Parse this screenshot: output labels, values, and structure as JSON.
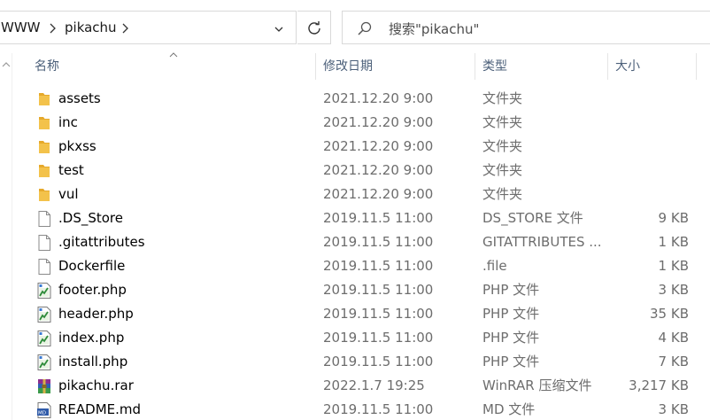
{
  "address": {
    "breadcrumbs": [
      "WWW",
      "pikachu"
    ]
  },
  "search": {
    "placeholder": "搜索\"pikachu\""
  },
  "columns": {
    "name": "名称",
    "date": "修改日期",
    "type": "类型",
    "size": "大小"
  },
  "files": [
    {
      "name": "assets",
      "date": "2021.12.20 9:00",
      "type": "文件夹",
      "size": "",
      "icon": "folder-icon"
    },
    {
      "name": "inc",
      "date": "2021.12.20 9:00",
      "type": "文件夹",
      "size": "",
      "icon": "folder-icon"
    },
    {
      "name": "pkxss",
      "date": "2021.12.20 9:00",
      "type": "文件夹",
      "size": "",
      "icon": "folder-icon"
    },
    {
      "name": "test",
      "date": "2021.12.20 9:00",
      "type": "文件夹",
      "size": "",
      "icon": "folder-icon"
    },
    {
      "name": "vul",
      "date": "2021.12.20 9:00",
      "type": "文件夹",
      "size": "",
      "icon": "folder-icon"
    },
    {
      "name": ".DS_Store",
      "date": "2019.11.5 11:00",
      "type": "DS_STORE 文件",
      "size": "9 KB",
      "icon": "file-icon"
    },
    {
      "name": ".gitattributes",
      "date": "2019.11.5 11:00",
      "type": "GITATTRIBUTES ...",
      "size": "1 KB",
      "icon": "file-icon"
    },
    {
      "name": "Dockerfile",
      "date": "2019.11.5 11:00",
      "type": ".file",
      "size": "1 KB",
      "icon": "file-icon"
    },
    {
      "name": "footer.php",
      "date": "2019.11.5 11:00",
      "type": "PHP 文件",
      "size": "3 KB",
      "icon": "php-file-icon"
    },
    {
      "name": "header.php",
      "date": "2019.11.5 11:00",
      "type": "PHP 文件",
      "size": "35 KB",
      "icon": "php-file-icon"
    },
    {
      "name": "index.php",
      "date": "2019.11.5 11:00",
      "type": "PHP 文件",
      "size": "4 KB",
      "icon": "php-file-icon"
    },
    {
      "name": "install.php",
      "date": "2019.11.5 11:00",
      "type": "PHP 文件",
      "size": "7 KB",
      "icon": "php-file-icon"
    },
    {
      "name": "pikachu.rar",
      "date": "2022.1.7 19:25",
      "type": "WinRAR 压缩文件",
      "size": "3,217 KB",
      "icon": "rar-archive-icon"
    },
    {
      "name": "README.md",
      "date": "2019.11.5 11:00",
      "type": "MD 文件",
      "size": "3 KB",
      "icon": "md-file-icon"
    }
  ],
  "colors": {
    "folder": "#f3c24b",
    "header_text": "#4c607a",
    "secondary_text": "#6d6d6d",
    "border": "#d9d9d9"
  }
}
